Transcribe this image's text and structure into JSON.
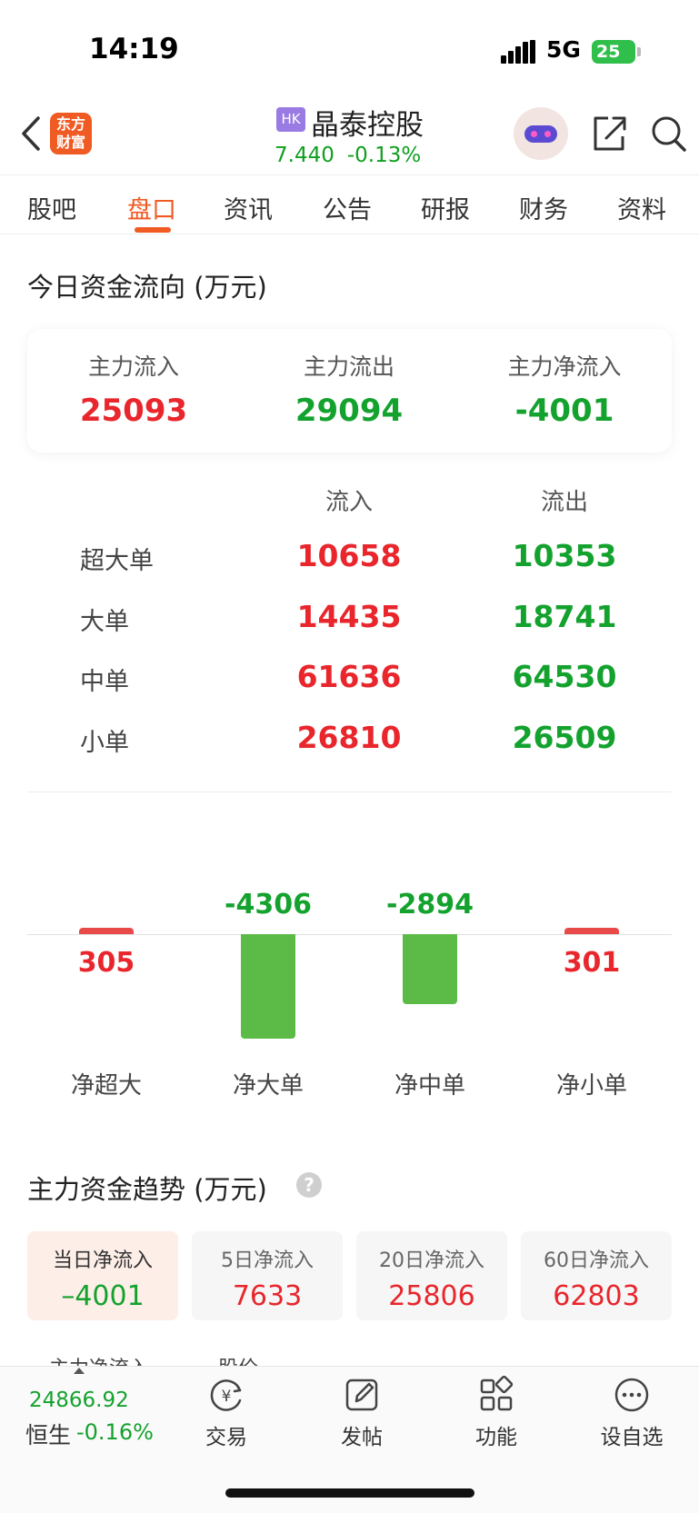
{
  "status_bar": {
    "time": "14:19",
    "network": "5G",
    "battery": "25"
  },
  "header": {
    "logo_line1": "东方",
    "logo_line2": "财富",
    "market_badge": "HK",
    "stock_name": "晶泰控股",
    "price": "7.440",
    "change_pct": "-0.13%"
  },
  "tabs": [
    "股吧",
    "盘口",
    "资讯",
    "公告",
    "研报",
    "财务",
    "资料"
  ],
  "active_tab": "盘口",
  "fund_flow": {
    "title": "今日资金流向 (万元)",
    "summary": [
      {
        "label": "主力流入",
        "value": "25093"
      },
      {
        "label": "主力流出",
        "value": "29094"
      },
      {
        "label": "主力净流入",
        "value": "-4001"
      }
    ],
    "table_headers": {
      "inflow": "流入",
      "outflow": "流出"
    },
    "rows": [
      {
        "label": "超大单",
        "inflow": "10658",
        "outflow": "10353"
      },
      {
        "label": "大单",
        "inflow": "14435",
        "outflow": "18741"
      },
      {
        "label": "中单",
        "inflow": "61636",
        "outflow": "64530"
      },
      {
        "label": "小单",
        "inflow": "26810",
        "outflow": "26509"
      }
    ]
  },
  "net_chart": {
    "bars": [
      {
        "label": "净超大",
        "value": 305,
        "display": "305"
      },
      {
        "label": "净大单",
        "value": -4306,
        "display": "-4306"
      },
      {
        "label": "净中单",
        "value": -2894,
        "display": "-2894"
      },
      {
        "label": "净小单",
        "value": 301,
        "display": "301"
      }
    ]
  },
  "trend": {
    "title": "主力资金趋势 (万元)",
    "help_icon": "?",
    "cards": [
      {
        "label": "当日净流入",
        "value": "–4001",
        "active": true
      },
      {
        "label": "5日净流入",
        "value": "7633",
        "active": false
      },
      {
        "label": "20日净流入",
        "value": "25806",
        "active": false
      },
      {
        "label": "60日净流入",
        "value": "62803",
        "active": false
      }
    ],
    "legend": [
      {
        "label": "主力净流入",
        "color": "#2a7de1"
      },
      {
        "label": "股价",
        "color": "#f0a020"
      }
    ]
  },
  "bottom_bar": {
    "index_value": "24866.92",
    "index_name": "恒生",
    "index_change": "-0.16%",
    "nav": [
      {
        "label": "交易",
        "icon": "trade-icon"
      },
      {
        "label": "发帖",
        "icon": "compose-icon"
      },
      {
        "label": "功能",
        "icon": "apps-icon"
      },
      {
        "label": "设自选",
        "icon": "more-icon"
      }
    ]
  },
  "colors": {
    "accent": "#f05a23",
    "up": "#e8262c",
    "down": "#14a22e"
  }
}
